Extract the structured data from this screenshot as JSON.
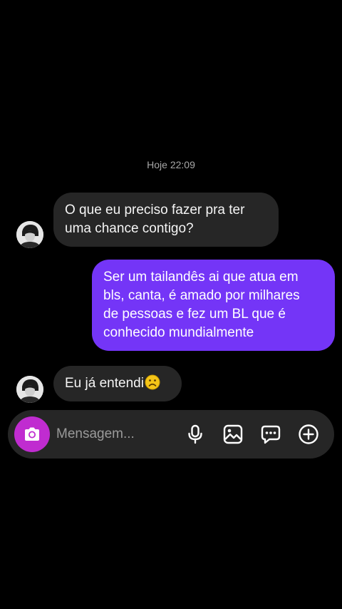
{
  "thread": {
    "timestamp": "Hoje 22:09",
    "messages": [
      {
        "direction": "incoming",
        "text": "O que eu preciso fazer pra ter\numa chance contigo?"
      },
      {
        "direction": "outgoing",
        "text": "Ser um tailandês ai que atua em\nbls, canta, é amado por milhares\nde pessoas e fez um BL que é\nconhecido mundialmente"
      },
      {
        "direction": "incoming",
        "text": "Eu já entendi",
        "emoji": "sad-face-emoji"
      }
    ]
  },
  "composer": {
    "placeholder": "Mensagem...",
    "value": "",
    "icons": [
      "camera-icon",
      "microphone-icon",
      "gallery-icon",
      "sticker-icon",
      "plus-icon"
    ]
  },
  "colors": {
    "background": "#000000",
    "incoming_bubble": "#262626",
    "outgoing_bubble": "#7435f7",
    "camera_button": "#c02cd0",
    "timestamp_text": "#a8a8a8"
  }
}
